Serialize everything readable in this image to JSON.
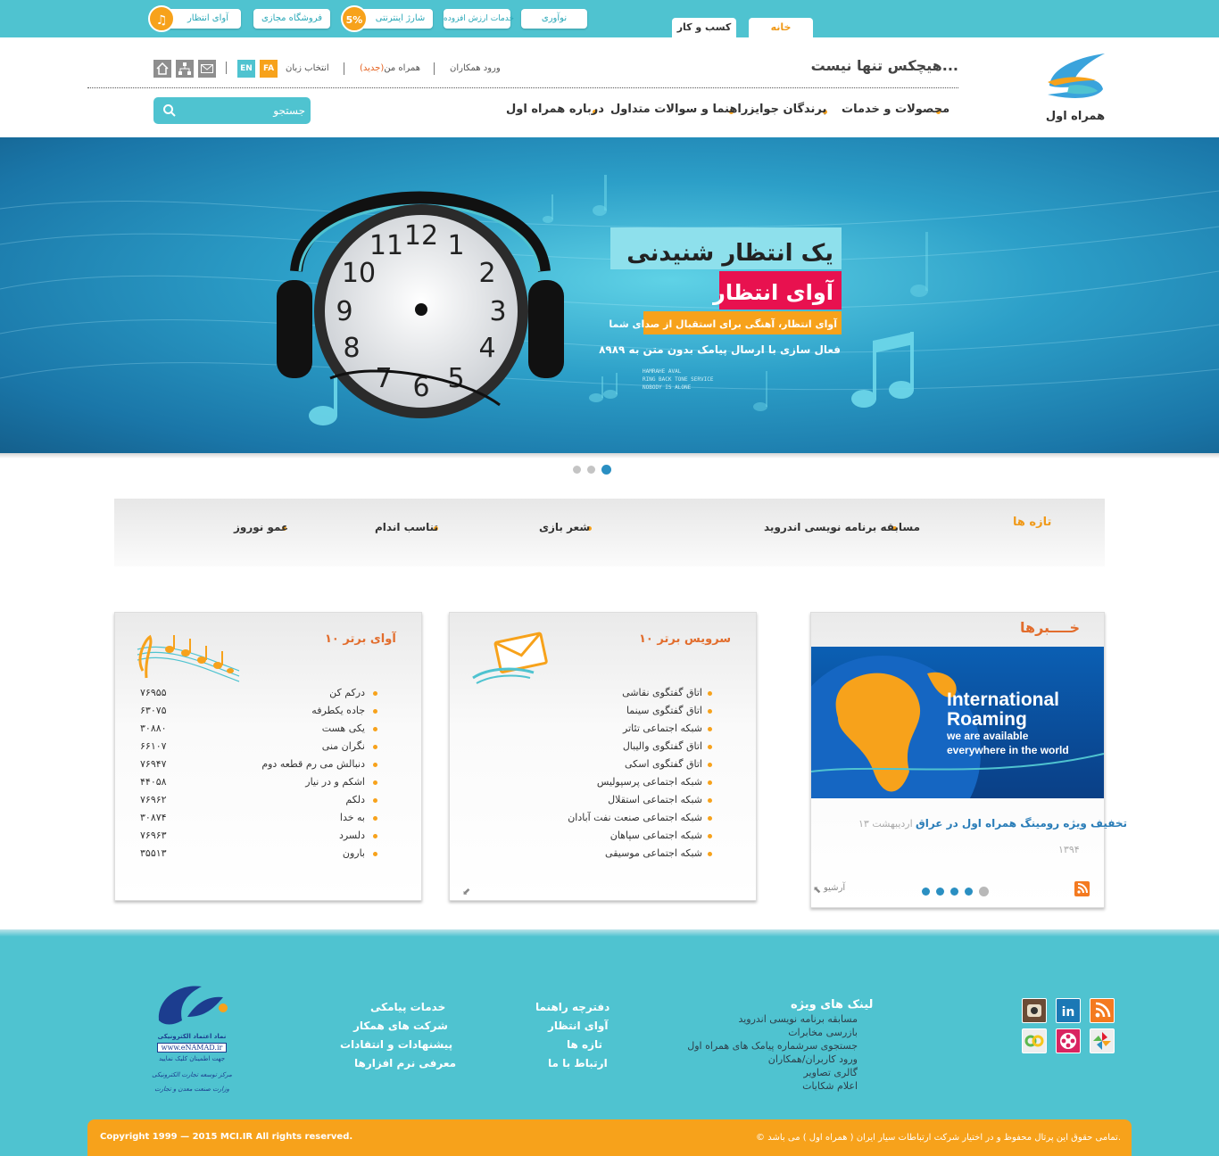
{
  "topbar": {
    "tabs": {
      "home": "خانه",
      "business": "کسب و کار"
    },
    "pills": {
      "innovation": "نوآوری",
      "vas": "خدمات ارزش افزوده",
      "charge": "شارژ اینترنتی",
      "charge_badge": "5%",
      "store": "فروشگاه مجازی",
      "rbt": "آوای انتظار"
    }
  },
  "header": {
    "slogan": "هیچکس تنها نیست...",
    "login_partners": "ورود همکاران",
    "hamrahe_man": "همراه من",
    "new_tag": "(جدید)",
    "language_select": "انتخاب زبان",
    "lang_fa": "FA",
    "lang_en": "EN",
    "logo_text": "همراه اول",
    "search_placeholder": "جستجو",
    "nav": [
      "محصولات و خدمات",
      "برندگان جوایز",
      "راهنما و سوالات متداول",
      "درباره همراه اول"
    ]
  },
  "banner": {
    "headline": "یک انتظار شنیدنی",
    "title": "آوای انتظار",
    "subtitle": "آوای انتظار، آهنگی برای استقبال از صدای شما",
    "activation": "فعال سازی با ارسال پیامک بدون متن به ۸۹۸۹",
    "english": [
      "HAMRAHE AVAL",
      "RING BACK TONE SERVICE",
      "NOBODY IS ALONE"
    ],
    "clock_numbers": [
      "12",
      "1",
      "2",
      "3",
      "4",
      "5",
      "6",
      "7",
      "8",
      "9",
      "10",
      "11"
    ]
  },
  "tazeh": {
    "title": "تازه ها",
    "items": [
      "مسابقه برنامه نویسی اندروید",
      "شعر بازی",
      "تناسب اندام",
      "عمو نوروز"
    ]
  },
  "news": {
    "title": "خــــبرها",
    "image_line1": "International",
    "image_line2": "Roaming",
    "image_line3": "we are available",
    "image_line4": "everywhere in the world",
    "headline": "تخفیف ویژه رومینگ همراه اول در عراق",
    "date_day": "۱۳ اردیبهشت",
    "date_year": "۱۳۹۴",
    "archive": "آرشیو"
  },
  "services": {
    "title": "۱۰ سرویس برتر",
    "items": [
      "اتاق گفتگوی نقاشی",
      "اتاق گفتگوی سینما",
      "شبکه اجتماعی تئاتر",
      "اتاق گفتگوی والیبال",
      "اتاق گفتگوی اسکی",
      "شبکه اجتماعی پرسپولیس",
      "شبکه اجتماعی استقلال",
      "شبکه اجتماعی صنعت نفت آبادان",
      "شبکه اجتماعی سپاهان",
      "شبکه اجتماعی موسیقی"
    ]
  },
  "tones": {
    "title": "۱۰ آوای برتر",
    "items": [
      {
        "name": "درکم کن",
        "code": "۷۶۹۵۵"
      },
      {
        "name": "جاده یکطرفه",
        "code": "۶۳۰۷۵"
      },
      {
        "name": "یکی هست",
        "code": "۳۰۸۸۰"
      },
      {
        "name": "نگران منی",
        "code": "۶۶۱۰۷"
      },
      {
        "name": "دنبالش می رم قطعه دوم",
        "code": "۷۶۹۴۷"
      },
      {
        "name": "اشکم و در نیار",
        "code": "۴۴۰۵۸"
      },
      {
        "name": "دلکم",
        "code": "۷۶۹۶۲"
      },
      {
        "name": "به خدا",
        "code": "۳۰۸۷۴"
      },
      {
        "name": "دلسرد",
        "code": "۷۶۹۶۳"
      },
      {
        "name": "بارون",
        "code": "۳۵۵۱۳"
      }
    ]
  },
  "footer": {
    "special_links_title": "لینک های ویژه",
    "special_links": [
      "مسابقه برنامه نویسی اندروید",
      "بازرسی مخابرات",
      "جستجوی سرشماره پیامک های همراه اول",
      "ورود کاربران/همکاران",
      "گالری تصاویر",
      "اعلام شکایات"
    ],
    "col2": [
      "دفترچه راهنما",
      "آوای انتظار",
      "تازه ها",
      "ارتباط با ما"
    ],
    "col3": [
      "خدمات پیامکی",
      "شرکت های همکار",
      "پیشنهادات و انتقادات",
      "معرفی نرم افزارها"
    ],
    "enamad": [
      "نماد اعتماد الکترونیکی",
      "www.eNAMAD.ir",
      "جهت اطمینان کلیک نمایید",
      "مرکز توسعه تجارت الکترونیکی",
      "وزارت صنعت معدن و تجارت"
    ],
    "copyright_en": "Copyright 1999 — 2015 MCI.IR All rights reserved.",
    "copyright_fa": "© تمامی حقوق این پرتال محفوظ و در اختیار شرکت ارتباطات سیار ایران ( همراه اول ) می باشد."
  },
  "colors": {
    "brand": "#4fc3d0",
    "accent": "#f7a21b",
    "title_orange": "#e26d2d"
  }
}
